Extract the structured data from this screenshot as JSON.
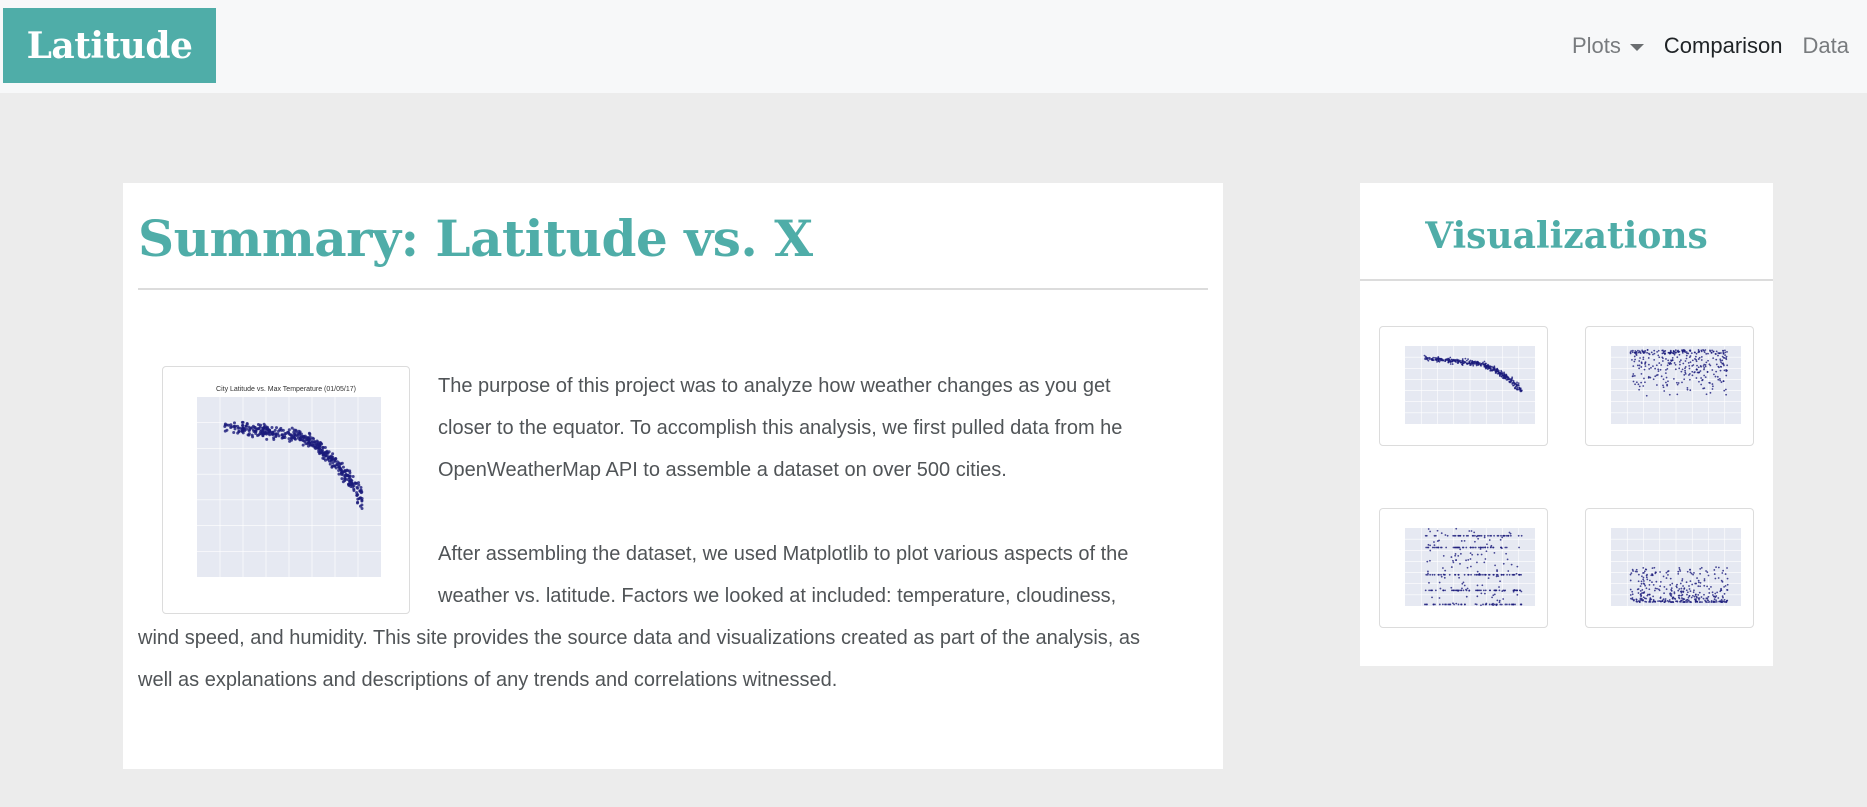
{
  "navbar": {
    "brand": "Latitude",
    "items": [
      {
        "label": "Plots",
        "dropdown": true
      },
      {
        "label": "Comparison",
        "active": true
      },
      {
        "label": "Data"
      }
    ]
  },
  "summary": {
    "title": "Summary: Latitude vs. X",
    "image_title": "City Latitude vs. Max Temperature (01/05/17)",
    "paragraph1": "The purpose of this project was to analyze how weather changes as you get closer to the equator. To accomplish this analysis, we first pulled data from he OpenWeatherMap API to assemble a dataset on over 500 cities.",
    "paragraph2": "After assembling the dataset, we used Matplotlib to plot various aspects of the weather vs. latitude. Factors we looked at included: temperature, cloudiness, wind speed, and humidity. This site provides the source data and visualizations created as part of the analysis, as well as explanations and descriptions of any trends and correlations witnessed."
  },
  "visualizations": {
    "title": "Visualizations",
    "thumbnails": [
      {
        "name": "max-temperature"
      },
      {
        "name": "humidity"
      },
      {
        "name": "cloudiness"
      },
      {
        "name": "wind-speed"
      }
    ]
  },
  "colors": {
    "accent": "#4fada8",
    "marker": "#1a1a7a",
    "plot_bg": "#e6e9f2"
  }
}
